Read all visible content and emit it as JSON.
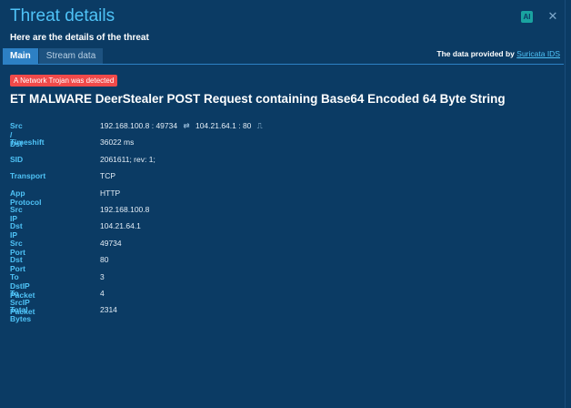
{
  "header": {
    "title": "Threat details",
    "subtitle": "Here are the details of the threat",
    "ai_label": "AI",
    "close_glyph": "✕"
  },
  "tabs": [
    {
      "label": "Main",
      "active": true
    },
    {
      "label": "Stream data",
      "active": false
    }
  ],
  "provider": {
    "prefix": "The data provided by",
    "link": "Suricata IDS"
  },
  "alert": {
    "badge": "A Network Trojan was detected",
    "name": "ET MALWARE DeerStealer POST Request containing Base64 Encoded 64 Byte String"
  },
  "details": {
    "src_dst": {
      "label": "Src / Dst",
      "src": "192.168.100.8 : 49734",
      "swap_icon": "⇄",
      "dst": "104.21.64.1 : 80",
      "wave_icon": "⎍"
    },
    "rows": [
      {
        "label": "Timeshift",
        "value": "36022 ms"
      },
      {
        "label": "SID",
        "value": "2061611; rev: 1;"
      },
      {
        "label": "Transport",
        "value": "TCP"
      },
      {
        "label": "App Protocol",
        "value": "HTTP"
      },
      {
        "label": "Src IP",
        "value": "192.168.100.8"
      },
      {
        "label": "Dst IP",
        "value": "104.21.64.1"
      },
      {
        "label": "Src Port",
        "value": "49734"
      },
      {
        "label": "Dst Port",
        "value": "80"
      },
      {
        "label": "To DstIP Packet",
        "value": "3"
      },
      {
        "label": "To SrcIP Packet",
        "value": "4"
      },
      {
        "label": "Total Bytes",
        "value": "2314"
      }
    ]
  },
  "colors": {
    "background": "#0b3b64",
    "accent": "#4fc3f7",
    "badge": "#f04a4a",
    "active_tab": "#2d80c4"
  }
}
